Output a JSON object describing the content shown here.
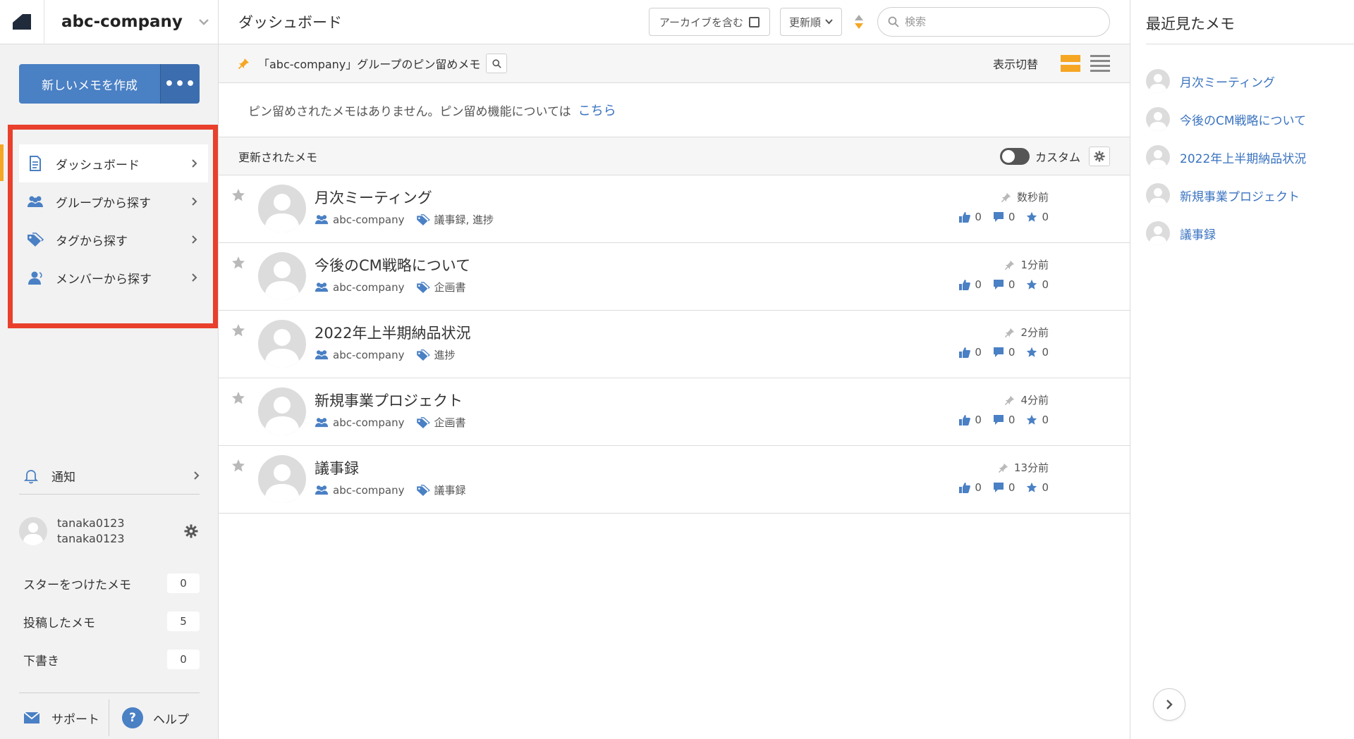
{
  "brand": {
    "name": "abc-company"
  },
  "sidebar": {
    "new_memo_label": "新しいメモを作成",
    "more_label": "•••",
    "nav": [
      {
        "label": "ダッシュボード",
        "icon": "document-icon",
        "active": true
      },
      {
        "label": "グループから探す",
        "icon": "group-icon",
        "active": false
      },
      {
        "label": "タグから探す",
        "icon": "tag-icon",
        "active": false
      },
      {
        "label": "メンバーから探す",
        "icon": "member-icon",
        "active": false
      }
    ],
    "notifications_label": "通知",
    "user": {
      "display_name": "tanaka0123",
      "username": "tanaka0123"
    },
    "counts": [
      {
        "label": "スターをつけたメモ",
        "value": "0"
      },
      {
        "label": "投稿したメモ",
        "value": "5"
      },
      {
        "label": "下書き",
        "value": "0"
      }
    ],
    "support_label": "サポート",
    "help_label": "ヘルプ",
    "help_icon_glyph": "?"
  },
  "header": {
    "title": "ダッシュボード",
    "archive_label": "アーカイブを含む",
    "sort_label": "更新順",
    "search_placeholder": "検索"
  },
  "pinned": {
    "title": "「abc-company」グループのピン留めメモ",
    "view_toggle_label": "表示切替",
    "empty_text": "ピン留めされたメモはありません。ピン留め機能については",
    "link_text": "こちら"
  },
  "updated": {
    "title": "更新されたメモ",
    "custom_label": "カスタム",
    "memos": [
      {
        "title": "月次ミーティング",
        "group": "abc-company",
        "tags": "議事録, 進捗",
        "time": "数秒前",
        "likes": "0",
        "comments": "0",
        "stars": "0"
      },
      {
        "title": "今後のCM戦略について",
        "group": "abc-company",
        "tags": "企画書",
        "time": "1分前",
        "likes": "0",
        "comments": "0",
        "stars": "0"
      },
      {
        "title": "2022年上半期納品状況",
        "group": "abc-company",
        "tags": "進捗",
        "time": "2分前",
        "likes": "0",
        "comments": "0",
        "stars": "0"
      },
      {
        "title": "新規事業プロジェクト",
        "group": "abc-company",
        "tags": "企画書",
        "time": "4分前",
        "likes": "0",
        "comments": "0",
        "stars": "0"
      },
      {
        "title": "議事録",
        "group": "abc-company",
        "tags": "議事録",
        "time": "13分前",
        "likes": "0",
        "comments": "0",
        "stars": "0"
      }
    ]
  },
  "recent": {
    "title": "最近見たメモ",
    "items": [
      "月次ミーティング",
      "今後のCM戦略について",
      "2022年上半期納品状況",
      "新規事業プロジェクト",
      "議事録"
    ]
  },
  "colors": {
    "accent_blue": "#4a80c4",
    "link_blue": "#3a73c0",
    "pin_orange": "#f5a623",
    "highlight_red": "#e8402c"
  }
}
